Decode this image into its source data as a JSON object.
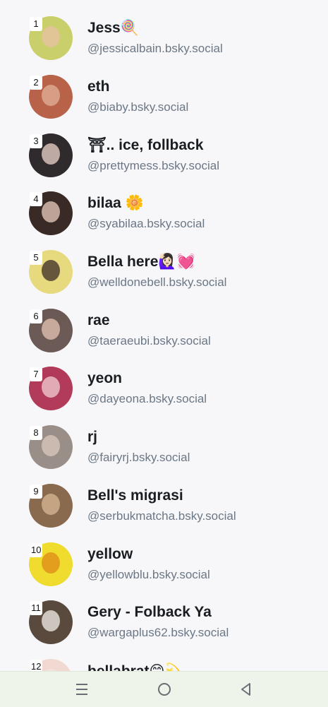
{
  "accounts": [
    {
      "rank": "1",
      "name": "Jess🍭",
      "handle": "@jessicalbain.bsky.social",
      "avatar_bg": "#c9cf6a",
      "avatar_fg": "#e8c2a6"
    },
    {
      "rank": "2",
      "name": "eth",
      "handle": "@biaby.bsky.social",
      "avatar_bg": "#b9624a",
      "avatar_fg": "#e2b39a"
    },
    {
      "rank": "3",
      "name": "⛩.. ice, follback",
      "handle": "@prettymess.bsky.social",
      "avatar_bg": "#2f2a2c",
      "avatar_fg": "#efd6cc"
    },
    {
      "rank": "4",
      "name": "bilaa 🌼",
      "handle": "@syabilaa.bsky.social",
      "avatar_bg": "#3a2a26",
      "avatar_fg": "#e9cdbf"
    },
    {
      "rank": "5",
      "name": "Bella here🙋🏻‍♀️💓",
      "handle": "@welldonebell.bsky.social",
      "avatar_bg": "#e7d97e",
      "avatar_fg": "#3b2b27"
    },
    {
      "rank": "6",
      "name": "rae",
      "handle": "@taeraeubi.bsky.social",
      "avatar_bg": "#6b5a55",
      "avatar_fg": "#e6c6b3"
    },
    {
      "rank": "7",
      "name": "yeon",
      "handle": "@dayeona.bsky.social",
      "avatar_bg": "#b23b5a",
      "avatar_fg": "#f2d0d4"
    },
    {
      "rank": "8",
      "name": "rj",
      "handle": "@fairyrj.bsky.social",
      "avatar_bg": "#9a8f88",
      "avatar_fg": "#d9c8bd"
    },
    {
      "rank": "9",
      "name": "Bell's migrasi",
      "handle": "@serbukmatcha.bsky.social",
      "avatar_bg": "#8a6a4f",
      "avatar_fg": "#d8b894"
    },
    {
      "rank": "10",
      "name": "yellow",
      "handle": "@yellowblu.bsky.social",
      "avatar_bg": "#f0dc2e",
      "avatar_fg": "#e08a1a"
    },
    {
      "rank": "11",
      "name": "Gery - Folback Ya",
      "handle": "@wargaplus62.bsky.social",
      "avatar_bg": "#5a4a3e",
      "avatar_fg": "#f3f0ea"
    },
    {
      "rank": "12",
      "name": "bellabrat😊💫",
      "handle": "",
      "avatar_bg": "#f1d8d0",
      "avatar_fg": "#f6e6e0"
    }
  ],
  "nav": {
    "items": [
      "menu-icon",
      "home-circle-icon",
      "back-triangle-icon"
    ],
    "color": "#6a6f75"
  }
}
